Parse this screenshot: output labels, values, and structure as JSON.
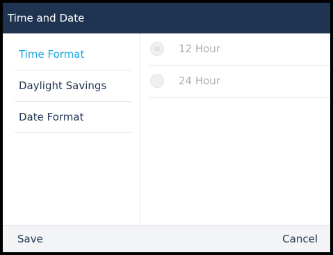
{
  "header": {
    "title": "Time and Date"
  },
  "sidebar": {
    "items": [
      {
        "label": "Time Format",
        "active": true
      },
      {
        "label": "Daylight Savings",
        "active": false
      },
      {
        "label": "Date Format",
        "active": false
      }
    ]
  },
  "content": {
    "options": [
      {
        "label": "12 Hour",
        "selected": true
      },
      {
        "label": "24 Hour",
        "selected": false
      }
    ]
  },
  "footer": {
    "save_label": "Save",
    "cancel_label": "Cancel"
  },
  "colors": {
    "titlebar_bg": "#1f3451",
    "accent_active": "#1aa7e0",
    "text_primary": "#1f3451",
    "text_disabled": "#a9aeb5",
    "footer_bg": "#f3f4f6"
  }
}
